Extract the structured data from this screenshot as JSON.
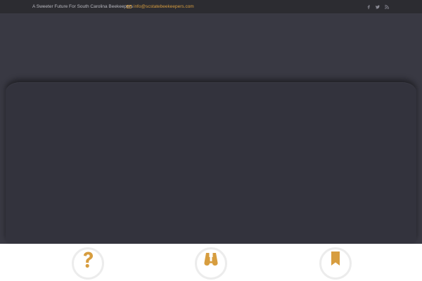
{
  "topbar": {
    "tagline": "A Sweeter Future For South Carolina Beekeepers",
    "email": "info@scstatebeekeepers.com",
    "email_icon": "envelope-icon",
    "social": [
      "facebook-icon",
      "twitter-icon",
      "rss-icon"
    ]
  },
  "features": {
    "items": [
      {
        "icon": "question-mark-icon"
      },
      {
        "icon": "binoculars-icon"
      },
      {
        "icon": "bookmark-icon"
      }
    ]
  },
  "colors": {
    "accent": "#d79d3f",
    "topbar_bg": "#2c2c31",
    "hero_bg": "#393943",
    "slider_bg": "#33333d",
    "features_bg": "#ffffff"
  }
}
